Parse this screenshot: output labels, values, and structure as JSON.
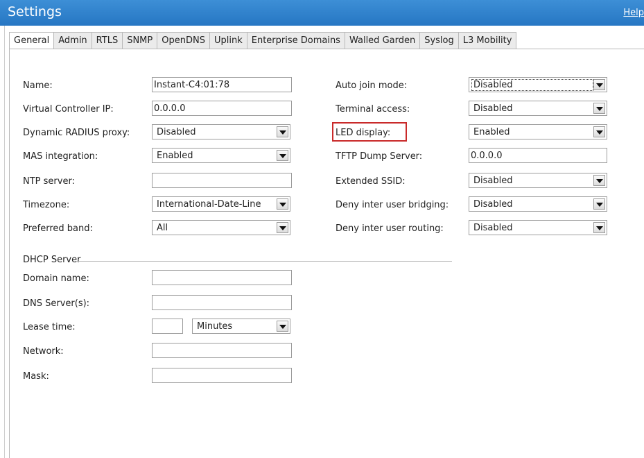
{
  "header": {
    "title": "Settings",
    "help": "Help"
  },
  "tabs": [
    "General",
    "Admin",
    "RTLS",
    "SNMP",
    "OpenDNS",
    "Uplink",
    "Enterprise Domains",
    "Walled Garden",
    "Syslog",
    "L3 Mobility"
  ],
  "left": {
    "name_label": "Name:",
    "name_value": "Instant-C4:01:78",
    "vcip_label": "Virtual Controller IP:",
    "vcip_value": "0.0.0.0",
    "radius_label": "Dynamic RADIUS proxy:",
    "radius_value": "Disabled",
    "mas_label": "MAS integration:",
    "mas_value": "Enabled",
    "ntp_label": "NTP server:",
    "ntp_value": "",
    "tz_label": "Timezone:",
    "tz_value": "International-Date-Line",
    "band_label": "Preferred band:",
    "band_value": "All"
  },
  "right": {
    "autojoin_label": "Auto join mode:",
    "autojoin_value": "Disabled",
    "terminal_label": "Terminal access:",
    "terminal_value": "Disabled",
    "led_label": "LED display:",
    "led_value": "Enabled",
    "tftp_label": "TFTP Dump Server:",
    "tftp_value": "0.0.0.0",
    "ssid_label": "Extended SSID:",
    "ssid_value": "Disabled",
    "bridging_label": "Deny inter user bridging:",
    "bridging_value": "Disabled",
    "routing_label": "Deny inter user routing:",
    "routing_value": "Disabled"
  },
  "dhcp": {
    "legend": "DHCP Server",
    "domain_label": "Domain name:",
    "domain_value": "",
    "dns_label": "DNS Server(s):",
    "dns_value": "",
    "lease_label": "Lease time:",
    "lease_value": "",
    "lease_unit": "Minutes",
    "network_label": "Network:",
    "network_value": "",
    "mask_label": "Mask:",
    "mask_value": ""
  },
  "colors": {
    "header_bg": "#2f80cc",
    "highlight": "#c92a2a"
  }
}
